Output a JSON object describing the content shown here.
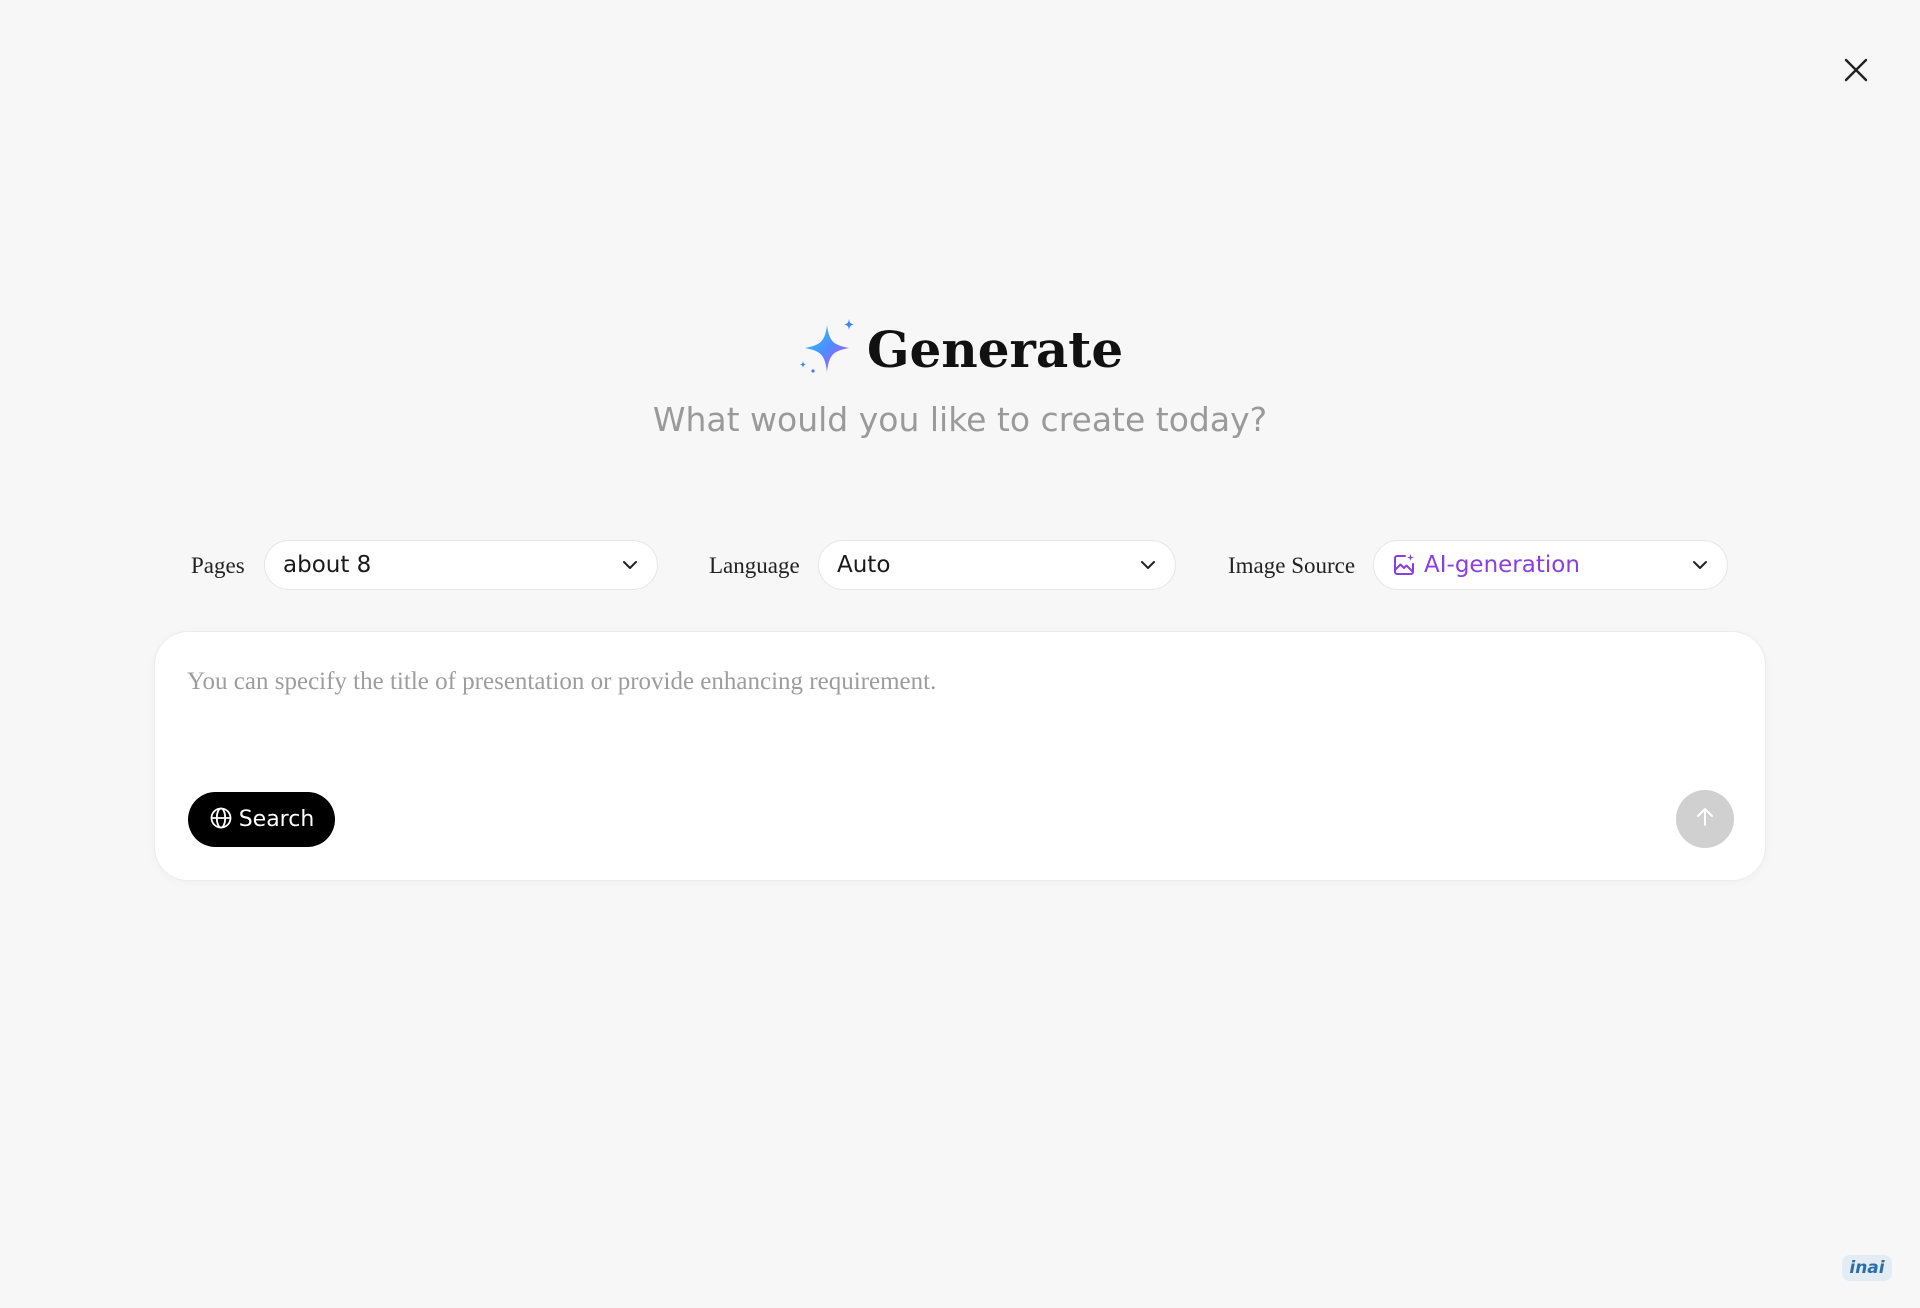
{
  "close": {
    "icon": "close-icon"
  },
  "header": {
    "icon": "sparkle-icon",
    "title": "Generate",
    "subtitle": "What would you like to create today?"
  },
  "options": {
    "pages": {
      "label": "Pages",
      "value": "about 8",
      "icon": "chevron-down-icon"
    },
    "language": {
      "label": "Language",
      "value": "Auto",
      "icon": "chevron-down-icon"
    },
    "image_source": {
      "label": "Image Source",
      "value": "AI-generation",
      "icon": "ai-image-icon",
      "value_color": "#8a3fe0"
    }
  },
  "prompt": {
    "placeholder": "You can specify the title of presentation or provide enhancing requirement.",
    "value": ""
  },
  "actions": {
    "search_label": "Search",
    "search_icon": "globe-icon",
    "send_icon": "arrow-up-icon"
  },
  "watermark": {
    "text": "inai"
  }
}
